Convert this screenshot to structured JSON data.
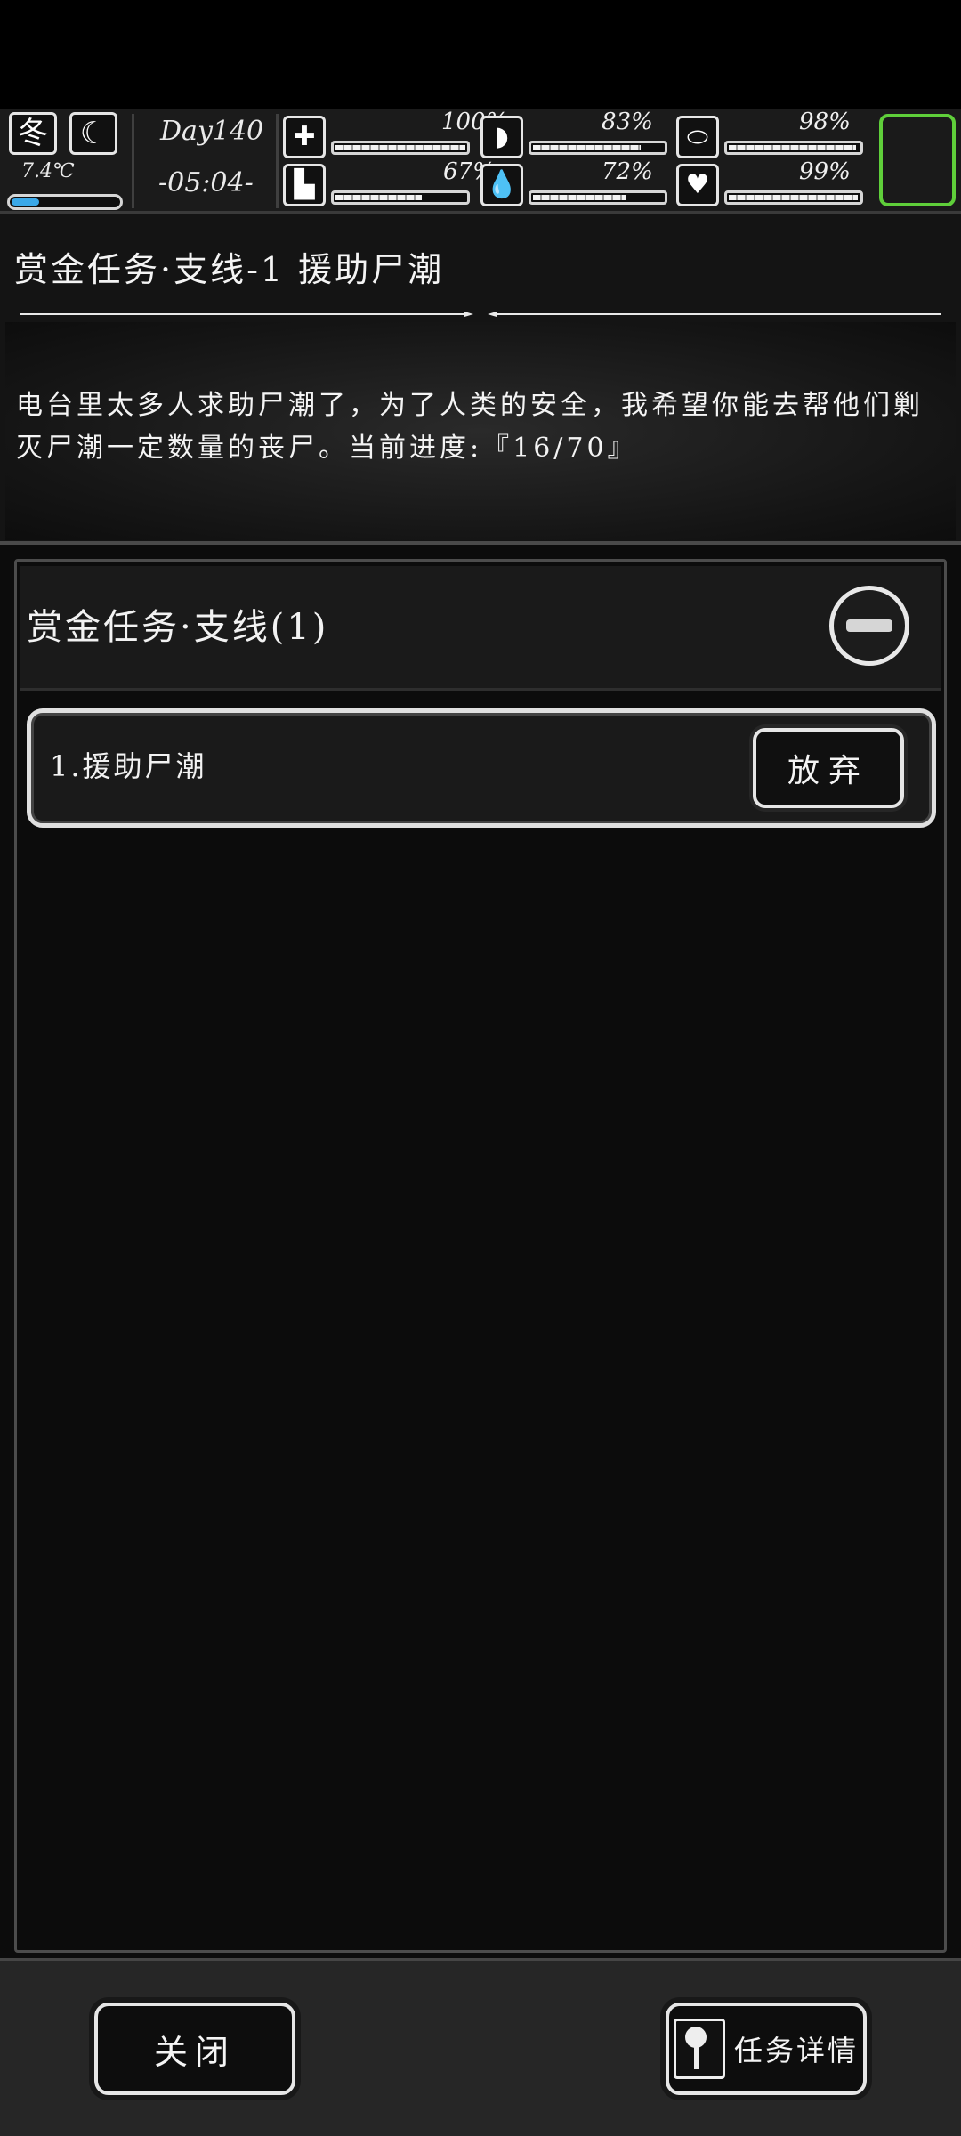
{
  "hud": {
    "season": "冬",
    "temperature": "7.4℃",
    "temperature_level": 0.28,
    "day": "Day140",
    "time": "-05:04-",
    "stats": [
      {
        "icon": "medkit-icon",
        "value": "100%",
        "level": 1.0
      },
      {
        "icon": "stomach-icon",
        "value": "83%",
        "level": 0.83
      },
      {
        "icon": "pill-icon",
        "value": "98%",
        "level": 0.98
      },
      {
        "icon": "boot-icon",
        "value": "67%",
        "level": 0.67
      },
      {
        "icon": "water-drop-icon",
        "value": "72%",
        "level": 0.72
      },
      {
        "icon": "heart-icon",
        "value": "99%",
        "level": 0.99
      }
    ],
    "status_color": "#5fcf3a"
  },
  "quest": {
    "title": "赏金任务·支线-1 援助尸潮",
    "description": "电台里太多人求助尸潮了，为了人类的安全，我希望你能去帮他们剿灭尸潮一定数量的丧尸。当前进度:『16/70』"
  },
  "list": {
    "category_label": "赏金任务·支线(1)",
    "tasks": [
      {
        "label": "1.援助尸潮",
        "action": "放弃"
      }
    ]
  },
  "footer": {
    "close_label": "关闭",
    "details_label": "任务详情"
  }
}
